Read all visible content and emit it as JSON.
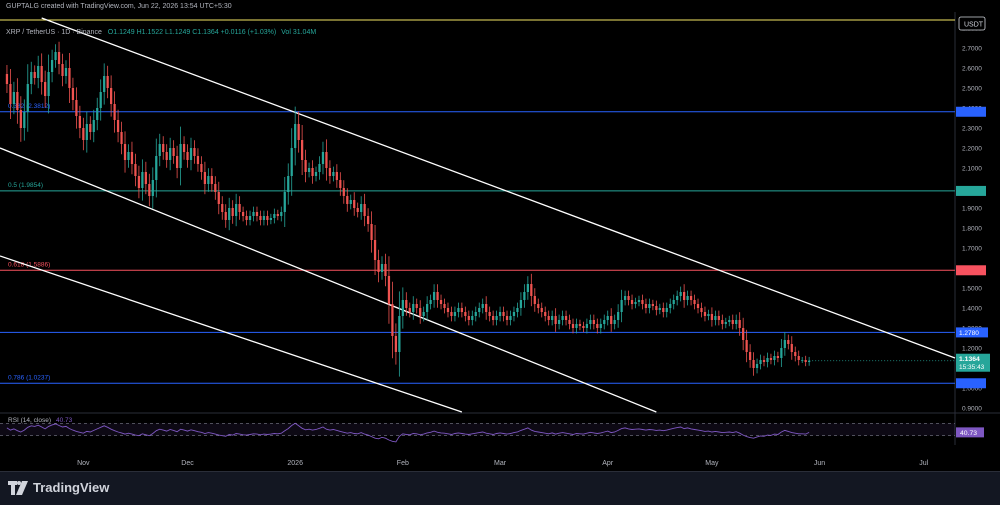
{
  "header": {
    "created_by": "GUPTALG created with TradingView.com, Jun 22, 2026 13:54 UTC+5:30",
    "symbol": "XRP / TetherUS · 1D · Binance",
    "ohlc": "O1.1249 H1.1522 L1.1249 C1.1364 +0.0116 (+1.03%)",
    "volume": "Vol 31.04M"
  },
  "footer": {
    "brand": "TradingView"
  },
  "colors": {
    "bull": "#26a69a",
    "bear": "#ef5350",
    "fib_blue": "#2962ff",
    "fib_green": "#26a69a",
    "fib_red": "#f7525f",
    "fib_yellow": "#f5e663",
    "rsi": "#7e57c2",
    "channel": "#ffffff"
  },
  "chart_data": [
    {
      "type": "candlestick",
      "title": "XRP / TetherUS · 1D · Binance",
      "currency": "USDT",
      "ylim": [
        0.88,
        2.88
      ],
      "yticks": [
        0.9,
        1.0,
        1.1,
        1.2,
        1.3,
        1.4,
        1.5,
        1.6,
        1.7,
        1.8,
        1.9,
        2.0,
        2.1,
        2.2,
        2.3,
        2.4,
        2.5,
        2.6,
        2.7,
        2.8
      ],
      "xlim": [
        "2025-10-08",
        "2026-07-10"
      ],
      "xticks": [
        {
          "label": "Nov",
          "date": "2025-11-01"
        },
        {
          "label": "Dec",
          "date": "2025-12-01"
        },
        {
          "label": "2026",
          "date": "2026-01-01"
        },
        {
          "label": "Feb",
          "date": "2026-02-01"
        },
        {
          "label": "Mar",
          "date": "2026-03-01"
        },
        {
          "label": "Apr",
          "date": "2026-04-01"
        },
        {
          "label": "May",
          "date": "2026-05-01"
        },
        {
          "label": "Jun",
          "date": "2026-06-01"
        },
        {
          "label": "Jul",
          "date": "2026-07-01"
        }
      ],
      "start_date": "2025-10-10",
      "closes": [
        2.52,
        2.42,
        2.48,
        2.39,
        2.3,
        2.38,
        2.52,
        2.58,
        2.55,
        2.61,
        2.53,
        2.46,
        2.58,
        2.64,
        2.68,
        2.62,
        2.56,
        2.6,
        2.5,
        2.44,
        2.36,
        2.3,
        2.24,
        2.32,
        2.28,
        2.34,
        2.4,
        2.48,
        2.56,
        2.5,
        2.42,
        2.34,
        2.28,
        2.22,
        2.14,
        2.18,
        2.12,
        2.06,
        2.0,
        2.08,
        2.02,
        1.96,
        2.04,
        2.16,
        2.22,
        2.18,
        2.14,
        2.2,
        2.16,
        2.1,
        2.22,
        2.18,
        2.14,
        2.2,
        2.16,
        2.12,
        2.08,
        2.02,
        2.06,
        2.02,
        1.98,
        1.92,
        1.88,
        1.84,
        1.9,
        1.86,
        1.92,
        1.88,
        1.86,
        1.84,
        1.86,
        1.88,
        1.86,
        1.84,
        1.86,
        1.84,
        1.85,
        1.87,
        1.86,
        1.88,
        1.98,
        2.06,
        2.2,
        2.32,
        2.24,
        2.14,
        2.08,
        2.1,
        2.06,
        2.08,
        2.12,
        2.18,
        2.1,
        2.06,
        2.08,
        2.04,
        2.0,
        1.96,
        1.92,
        1.94,
        1.9,
        1.88,
        1.92,
        1.86,
        1.82,
        1.74,
        1.64,
        1.58,
        1.62,
        1.56,
        1.42,
        1.26,
        1.18,
        1.36,
        1.44,
        1.4,
        1.38,
        1.42,
        1.4,
        1.36,
        1.38,
        1.42,
        1.44,
        1.48,
        1.44,
        1.42,
        1.4,
        1.38,
        1.36,
        1.38,
        1.4,
        1.38,
        1.36,
        1.34,
        1.36,
        1.38,
        1.4,
        1.42,
        1.38,
        1.36,
        1.34,
        1.36,
        1.38,
        1.36,
        1.34,
        1.36,
        1.38,
        1.4,
        1.44,
        1.48,
        1.52,
        1.46,
        1.42,
        1.4,
        1.38,
        1.36,
        1.34,
        1.36,
        1.32,
        1.34,
        1.36,
        1.34,
        1.32,
        1.3,
        1.32,
        1.31,
        1.3,
        1.32,
        1.34,
        1.32,
        1.3,
        1.32,
        1.34,
        1.36,
        1.32,
        1.34,
        1.38,
        1.44,
        1.46,
        1.44,
        1.42,
        1.43,
        1.44,
        1.42,
        1.4,
        1.42,
        1.41,
        1.39,
        1.4,
        1.38,
        1.4,
        1.42,
        1.44,
        1.46,
        1.48,
        1.44,
        1.46,
        1.44,
        1.42,
        1.4,
        1.38,
        1.36,
        1.37,
        1.34,
        1.36,
        1.34,
        1.32,
        1.33,
        1.34,
        1.32,
        1.34,
        1.3,
        1.24,
        1.18,
        1.14,
        1.1,
        1.12,
        1.14,
        1.13,
        1.15,
        1.14,
        1.16,
        1.15,
        1.2,
        1.24,
        1.22,
        1.18,
        1.16,
        1.14,
        1.14,
        1.13,
        1.1364
      ],
      "fib_levels": [
        {
          "label": "0.382 (2.3812)",
          "value": 2.3812,
          "color": "#2962ff"
        },
        {
          "label": "0.5 (1.9854)",
          "value": 1.9854,
          "color": "#26a69a"
        },
        {
          "label": "0.618 (1.5886)",
          "value": 1.5886,
          "color": "#f7525f"
        },
        {
          "label": "0.786 (1.0237)",
          "value": 1.0237,
          "color": "#2962ff"
        }
      ],
      "top_level_value": 2.84,
      "horizontal_lines": [
        {
          "value": 1.278,
          "label": "1.2780",
          "color": "#2962ff"
        }
      ],
      "current_price": {
        "value": 1.1364,
        "label": "1.1364",
        "countdown": "15:35:43"
      },
      "channel_lines": [
        {
          "from": {
            "date": "2025-10-20",
            "price": 2.85
          },
          "to": {
            "date": "2026-07-10",
            "price": 1.15
          }
        },
        {
          "from": {
            "date": "2025-10-08",
            "price": 2.2
          },
          "to": {
            "date": "2026-04-15",
            "price": 0.88
          }
        },
        {
          "from": {
            "date": "2025-10-08",
            "price": 1.66
          },
          "to": {
            "date": "2026-02-18",
            "price": 0.88
          }
        }
      ]
    },
    {
      "type": "line",
      "title": "RSI (14, close)",
      "value_label": "40.73",
      "ylim": [
        0,
        100
      ],
      "bands": [
        30,
        70
      ],
      "values": [
        55,
        48,
        52,
        46,
        42,
        48,
        57,
        62,
        60,
        64,
        58,
        52,
        60,
        65,
        68,
        63,
        58,
        60,
        53,
        48,
        44,
        41,
        38,
        44,
        42,
        47,
        52,
        57,
        62,
        57,
        51,
        46,
        42,
        39,
        35,
        38,
        35,
        32,
        30,
        36,
        33,
        30,
        37,
        46,
        51,
        48,
        45,
        50,
        47,
        43,
        51,
        48,
        45,
        49,
        46,
        43,
        41,
        37,
        40,
        38,
        35,
        32,
        30,
        28,
        34,
        32,
        37,
        35,
        33,
        32,
        34,
        36,
        35,
        33,
        35,
        34,
        35,
        37,
        36,
        38,
        46,
        53,
        63,
        70,
        62,
        54,
        49,
        51,
        48,
        50,
        54,
        58,
        51,
        48,
        50,
        47,
        44,
        41,
        38,
        40,
        37,
        36,
        40,
        35,
        32,
        27,
        22,
        20,
        25,
        22,
        16,
        12,
        10,
        28,
        36,
        34,
        33,
        37,
        36,
        33,
        35,
        39,
        41,
        45,
        41,
        39,
        38,
        36,
        34,
        37,
        39,
        37,
        35,
        34,
        36,
        38,
        40,
        42,
        38,
        36,
        34,
        37,
        39,
        37,
        35,
        37,
        40,
        42,
        47,
        51,
        55,
        48,
        44,
        42,
        40,
        38,
        36,
        39,
        35,
        38,
        40,
        38,
        36,
        34,
        37,
        36,
        35,
        38,
        41,
        39,
        37,
        39,
        42,
        45,
        40,
        42,
        47,
        53,
        55,
        52,
        50,
        51,
        52,
        50,
        48,
        50,
        49,
        47,
        48,
        46,
        48,
        51,
        54,
        56,
        58,
        53,
        55,
        52,
        50,
        48,
        46,
        44,
        45,
        42,
        44,
        42,
        40,
        41,
        42,
        40,
        43,
        38,
        32,
        27,
        24,
        22,
        26,
        29,
        28,
        32,
        31,
        35,
        34,
        42,
        47,
        44,
        40,
        38,
        36,
        36,
        35,
        40.73
      ]
    }
  ]
}
